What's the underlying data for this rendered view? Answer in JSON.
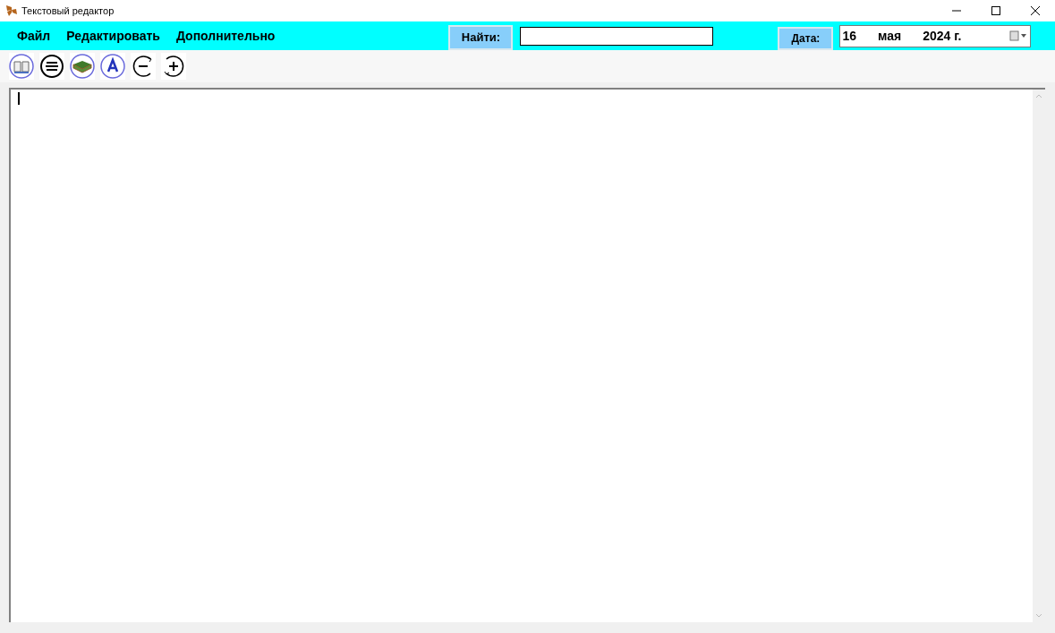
{
  "window": {
    "title": "Текстовый редактор"
  },
  "menu": [
    "Файл",
    "Редактировать",
    "Дополнительно"
  ],
  "search": {
    "label": "Найти:"
  },
  "date": {
    "label": "Дата:",
    "day": "16",
    "month": "мая",
    "year": "2024 г."
  },
  "toolbar": [
    {
      "kind": "book"
    },
    {
      "kind": "lines"
    },
    {
      "kind": "books"
    },
    {
      "kind": "font"
    },
    {
      "kind": "minus"
    },
    {
      "kind": "plus"
    }
  ]
}
